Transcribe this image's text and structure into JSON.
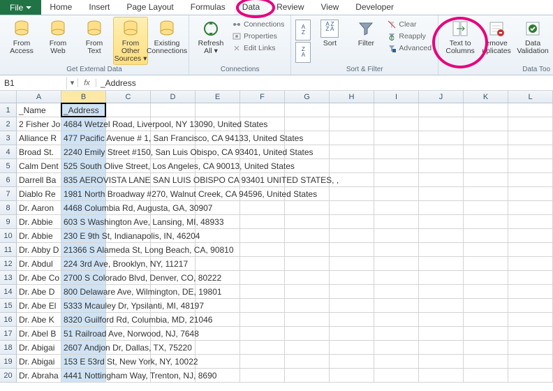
{
  "tabs": [
    "Home",
    "Insert",
    "Page Layout",
    "Formulas",
    "Data",
    "Review",
    "View",
    "Developer"
  ],
  "file": "File",
  "ribbon": {
    "getexternal": {
      "label": "Get External Data",
      "btns": [
        {
          "l1": "From",
          "l2": "Access"
        },
        {
          "l1": "From",
          "l2": "Web"
        },
        {
          "l1": "From",
          "l2": "Text"
        },
        {
          "l1": "From Other",
          "l2": "Sources ▾"
        },
        {
          "l1": "Existing",
          "l2": "Connections"
        }
      ]
    },
    "connections": {
      "label": "Connections",
      "refresh": {
        "l1": "Refresh",
        "l2": "All ▾"
      },
      "items": [
        "Connections",
        "Properties",
        "Edit Links"
      ]
    },
    "sortfilter": {
      "label": "Sort & Filter",
      "sort": "Sort",
      "filter": "Filter",
      "items": [
        "Clear",
        "Reapply",
        "Advanced"
      ]
    },
    "datatools": {
      "label": "Data Too",
      "btns": [
        {
          "l1": "Text to",
          "l2": "Columns"
        },
        {
          "l1": "emove",
          "l2": "uplicates"
        },
        {
          "l1": "Data",
          "l2": "Validation"
        }
      ]
    }
  },
  "namebox": "B1",
  "formula": "_Address",
  "columns": [
    "A",
    "B",
    "C",
    "D",
    "E",
    "F",
    "G",
    "H",
    "I",
    "J",
    "K",
    "L"
  ],
  "headers": [
    "_Name",
    "_Address"
  ],
  "rows": [
    {
      "n": "2 Fisher Jo",
      "a": "4684 Wetzel Road, Liverpool, NY 13090, United States"
    },
    {
      "n": "Alliance R",
      "a": "477 Pacific Avenue # 1, San Francisco, CA 94133, United States"
    },
    {
      "n": "Broad St. ",
      "a": "2240 Emily Street #150, San Luis Obispo, CA 93401, United States"
    },
    {
      "n": "Calm Dent",
      "a": "525 South Olive Street, Los Angeles, CA 90013, United States"
    },
    {
      "n": "Darrell Ba",
      "a": "835 AEROVISTA LANE  SAN LUIS OBISPO  CA 93401  UNITED STATES, ,"
    },
    {
      "n": "Diablo Re",
      "a": "1981 North Broadway #270, Walnut Creek, CA 94596, United States"
    },
    {
      "n": "Dr. Aaron ",
      "a": "4468 Columbia Rd, Augusta, GA, 30907"
    },
    {
      "n": "Dr. Abbie ",
      "a": "603 S Washington Ave, Lansing, MI, 48933"
    },
    {
      "n": "Dr. Abbie ",
      "a": "230 E 9th St, Indianapolis, IN, 46204"
    },
    {
      "n": "Dr. Abby D",
      "a": "21366 S Alameda St, Long Beach, CA, 90810"
    },
    {
      "n": "Dr. Abdul ",
      "a": "224 3rd Ave, Brooklyn, NY, 11217"
    },
    {
      "n": "Dr. Abe Co",
      "a": "2700 S Colorado Blvd, Denver, CO, 80222"
    },
    {
      "n": "Dr. Abe D",
      "a": "800 Delaware Ave, Wilmington, DE, 19801"
    },
    {
      "n": "Dr. Abe El",
      "a": "5333 Mcauley Dr, Ypsilanti, MI, 48197"
    },
    {
      "n": "Dr. Abe K",
      "a": "8320 Guilford Rd, Columbia, MD, 21046"
    },
    {
      "n": "Dr. Abel B",
      "a": "51 Railroad Ave, Norwood, NJ, 7648"
    },
    {
      "n": "Dr. Abigai",
      "a": "2607 Andjon Dr, Dallas, TX, 75220"
    },
    {
      "n": "Dr. Abigai",
      "a": "153 E 53rd St, New York, NY, 10022"
    },
    {
      "n": "Dr. Abraha",
      "a": "4441 Nottingham Way, Trenton, NJ, 8690"
    }
  ]
}
